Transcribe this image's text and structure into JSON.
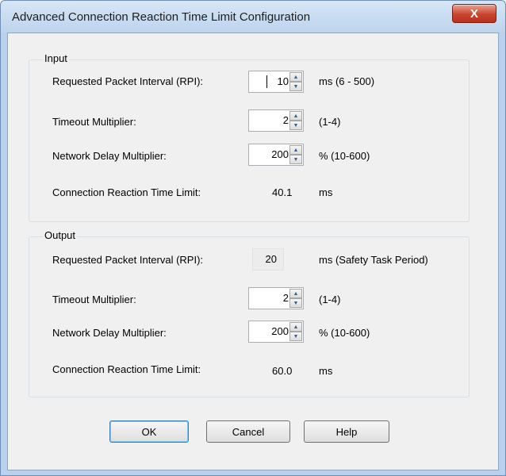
{
  "window": {
    "title": "Advanced Connection Reaction Time Limit Configuration",
    "close_glyph": "X"
  },
  "input": {
    "group_label": "Input",
    "rpi": {
      "label": "Requested Packet Interval (RPI):",
      "value": "10",
      "range": "ms (6 - 500)"
    },
    "timeout": {
      "label": "Timeout Multiplier:",
      "value": "2",
      "range": "(1-4)"
    },
    "delay": {
      "label": "Network Delay Multiplier:",
      "value": "200",
      "range": "% (10-600)"
    },
    "crtl": {
      "label": "Connection Reaction Time Limit:",
      "value": "40.1",
      "unit": "ms"
    }
  },
  "output": {
    "group_label": "Output",
    "rpi": {
      "label": "Requested Packet Interval (RPI):",
      "value": "20",
      "range": "ms (Safety Task Period)"
    },
    "timeout": {
      "label": "Timeout Multiplier:",
      "value": "2",
      "range": "(1-4)"
    },
    "delay": {
      "label": "Network Delay Multiplier:",
      "value": "200",
      "range": "% (10-600)"
    },
    "crtl": {
      "label": "Connection Reaction Time Limit:",
      "value": "60.0",
      "unit": "ms"
    }
  },
  "buttons": {
    "ok": "OK",
    "cancel": "Cancel",
    "help": "Help"
  },
  "glyphs": {
    "up": "▲",
    "down": "▼"
  }
}
